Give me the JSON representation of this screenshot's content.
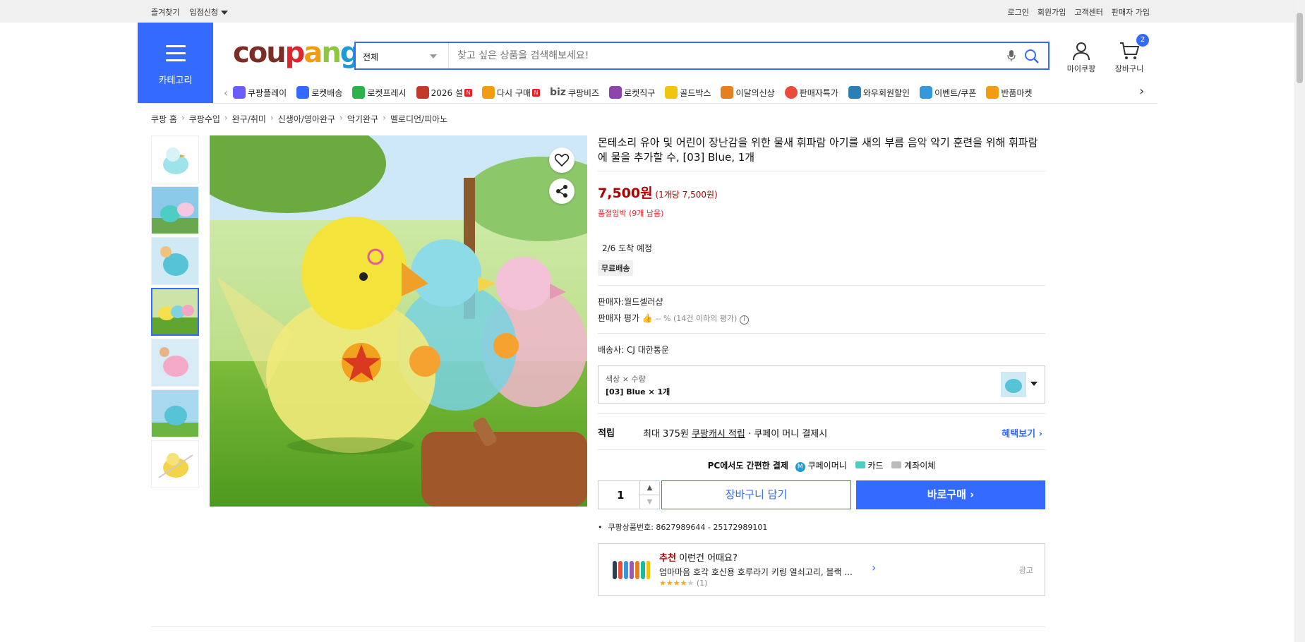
{
  "topbar": {
    "favorites": "즐겨찾기",
    "entry": "입점신청",
    "login": "로그인",
    "signup": "회원가입",
    "support": "고객센터",
    "seller_signup": "판매자 가입"
  },
  "header": {
    "category_label": "카테고리",
    "logo": [
      "cou",
      "p",
      "a",
      "n",
      "g"
    ],
    "search_scope": "전체",
    "search_placeholder": "찾고 싶은 상품을 검색해보세요!",
    "mycoupang": "마이쿠팡",
    "cart": "장바구니",
    "cart_count": "2"
  },
  "nav": {
    "items": [
      {
        "label": "쿠팡플레이",
        "color": "#6a5cff"
      },
      {
        "label": "로켓배송",
        "color": "#346aff"
      },
      {
        "label": "로켓프레시",
        "color": "#2bb24c"
      },
      {
        "label": "2026 설",
        "color": "#c0392b",
        "badge": "N"
      },
      {
        "label": "다시 구매",
        "color": "#f39c12",
        "badge": "N"
      },
      {
        "label": "쿠팡비즈",
        "color": "#555555",
        "prefix": "biz"
      },
      {
        "label": "로켓직구",
        "color": "#8e44ad"
      },
      {
        "label": "골드박스",
        "color": "#f1c40f"
      },
      {
        "label": "이달의신상",
        "color": "#e67e22"
      },
      {
        "label": "판매자특가",
        "color": "#e74c3c"
      },
      {
        "label": "와우회원할인",
        "color": "#2980b9"
      },
      {
        "label": "이벤트/쿠폰",
        "color": "#3498db"
      },
      {
        "label": "반품마켓",
        "color": "#f39c12"
      }
    ]
  },
  "breadcrumb": [
    "쿠팡 홈",
    "쿠팡수입",
    "완구/취미",
    "신생아/영아완구",
    "악기완구",
    "멜로디언/피아노"
  ],
  "product": {
    "title": "몬테소리 유아 및 어린이 장난감을 위한 물새 휘파람 아기를 새의 부름 음악 악기 훈련을 위해 휘파람에 물을 추가할 수, [03] Blue, 1개",
    "price": "7,500원",
    "unit_price": "(1개당 7,500원)",
    "stock": "품절임박 (9개 남음)",
    "arrival": "2/6 도착 예정",
    "shipping_tag": "무료배송",
    "seller": "판매자:월드셀러샵",
    "seller_rating_label": "판매자 평가",
    "seller_rating_value": "-- % (14건 이하의 평가)",
    "carrier": "배송사:  CJ 대한통운",
    "option_label": "색상 × 수량",
    "option_value": "[03] Blue × 1개",
    "reward_label": "적립",
    "reward_prefix": "최대 375원",
    "reward_link": "쿠팡캐시 적립",
    "reward_suffix": "· 쿠페이 머니 결제시",
    "benefit_link": "혜택보기",
    "pay_label": "PC에서도 간편한 결제",
    "pay_methods": [
      "쿠페이머니",
      "카드",
      "계좌이체"
    ],
    "quantity": "1",
    "add_to_cart": "장바구니 담기",
    "buy_now": "바로구매",
    "product_number": "쿠팡상품번호: 8627989644 - 25172989101"
  },
  "recommend": {
    "prefix": "추천",
    "heading": "이런건 어때요?",
    "item": "엄마마음 호각 호신용 호루라기 키링 열쇠고리, 블랙 ...",
    "reviews": "(1)",
    "ad": "광고"
  },
  "colors": {
    "accent": "#346aff",
    "price": "#ae0000"
  }
}
